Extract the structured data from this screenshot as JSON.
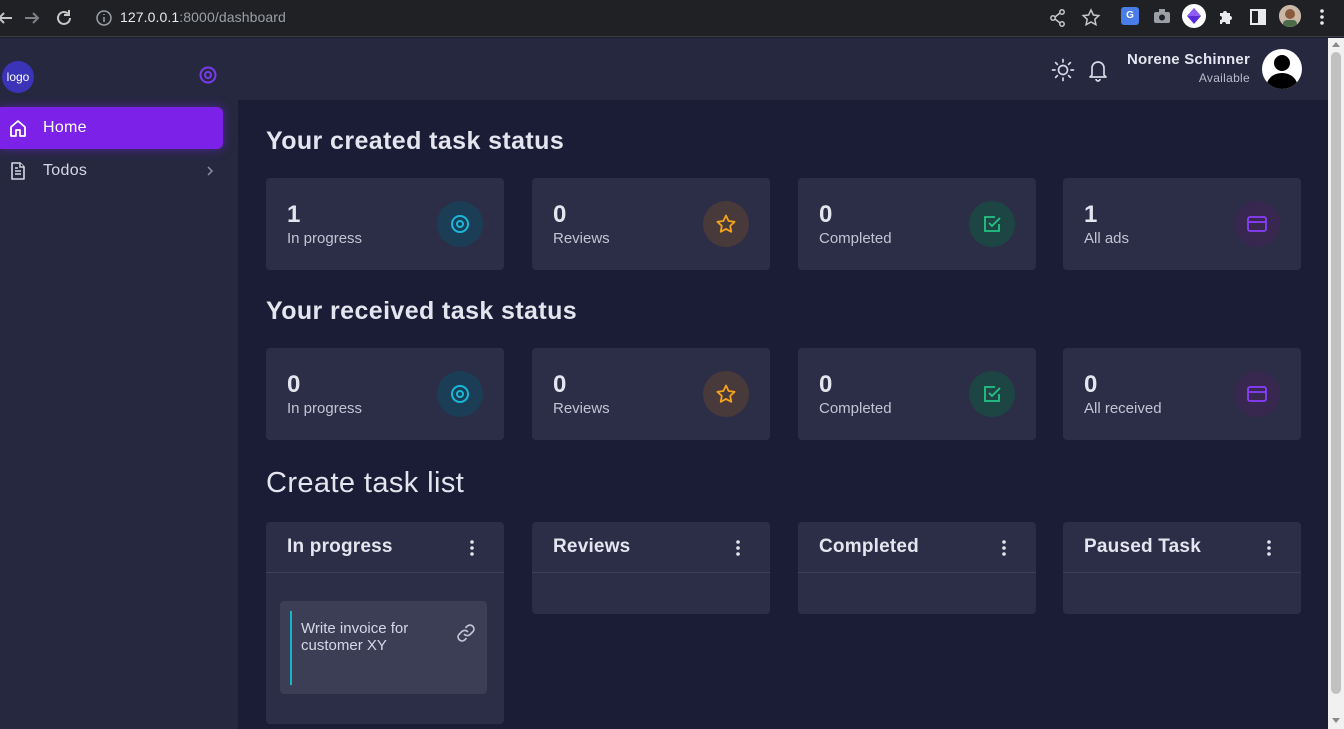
{
  "browser": {
    "url_host": "127.0.0.1",
    "url_rest": ":8000/dashboard",
    "ext_g_label": "G"
  },
  "sidebar": {
    "logo": "logo",
    "items": [
      {
        "label": "Home",
        "icon": "home-icon",
        "active": true
      },
      {
        "label": "Todos",
        "icon": "document-icon",
        "active": false
      }
    ]
  },
  "header": {
    "user_name": "Norene Schinner",
    "user_status": "Available"
  },
  "created": {
    "title": "Your created task status",
    "cards": [
      {
        "value": "1",
        "label": "In progress",
        "icon": "target-icon",
        "color": "#19b8d8"
      },
      {
        "value": "0",
        "label": "Reviews",
        "icon": "star-icon",
        "color": "#f4a21b"
      },
      {
        "value": "0",
        "label": "Completed",
        "icon": "check-square-icon",
        "color": "#22c585"
      },
      {
        "value": "1",
        "label": "All ads",
        "icon": "card-icon",
        "color": "#8b3dff"
      }
    ]
  },
  "received": {
    "title": "Your received task status",
    "cards": [
      {
        "value": "0",
        "label": "In progress",
        "icon": "target-icon",
        "color": "#19b8d8"
      },
      {
        "value": "0",
        "label": "Reviews",
        "icon": "star-icon",
        "color": "#f4a21b"
      },
      {
        "value": "0",
        "label": "Completed",
        "icon": "check-square-icon",
        "color": "#22c585"
      },
      {
        "value": "0",
        "label": "All received",
        "icon": "card-icon",
        "color": "#8b3dff"
      }
    ]
  },
  "tasklist": {
    "title": "Create task list",
    "columns": [
      {
        "title": "In progress",
        "tasks": [
          {
            "text": "Write invoice for customer XY"
          }
        ]
      },
      {
        "title": "Reviews",
        "tasks": []
      },
      {
        "title": "Completed",
        "tasks": []
      },
      {
        "title": "Paused Task",
        "tasks": []
      }
    ]
  },
  "colors": {
    "accent": "#7c22e8",
    "background": "#1b1c36",
    "panel": "#262840",
    "card": "#2c2e47"
  }
}
